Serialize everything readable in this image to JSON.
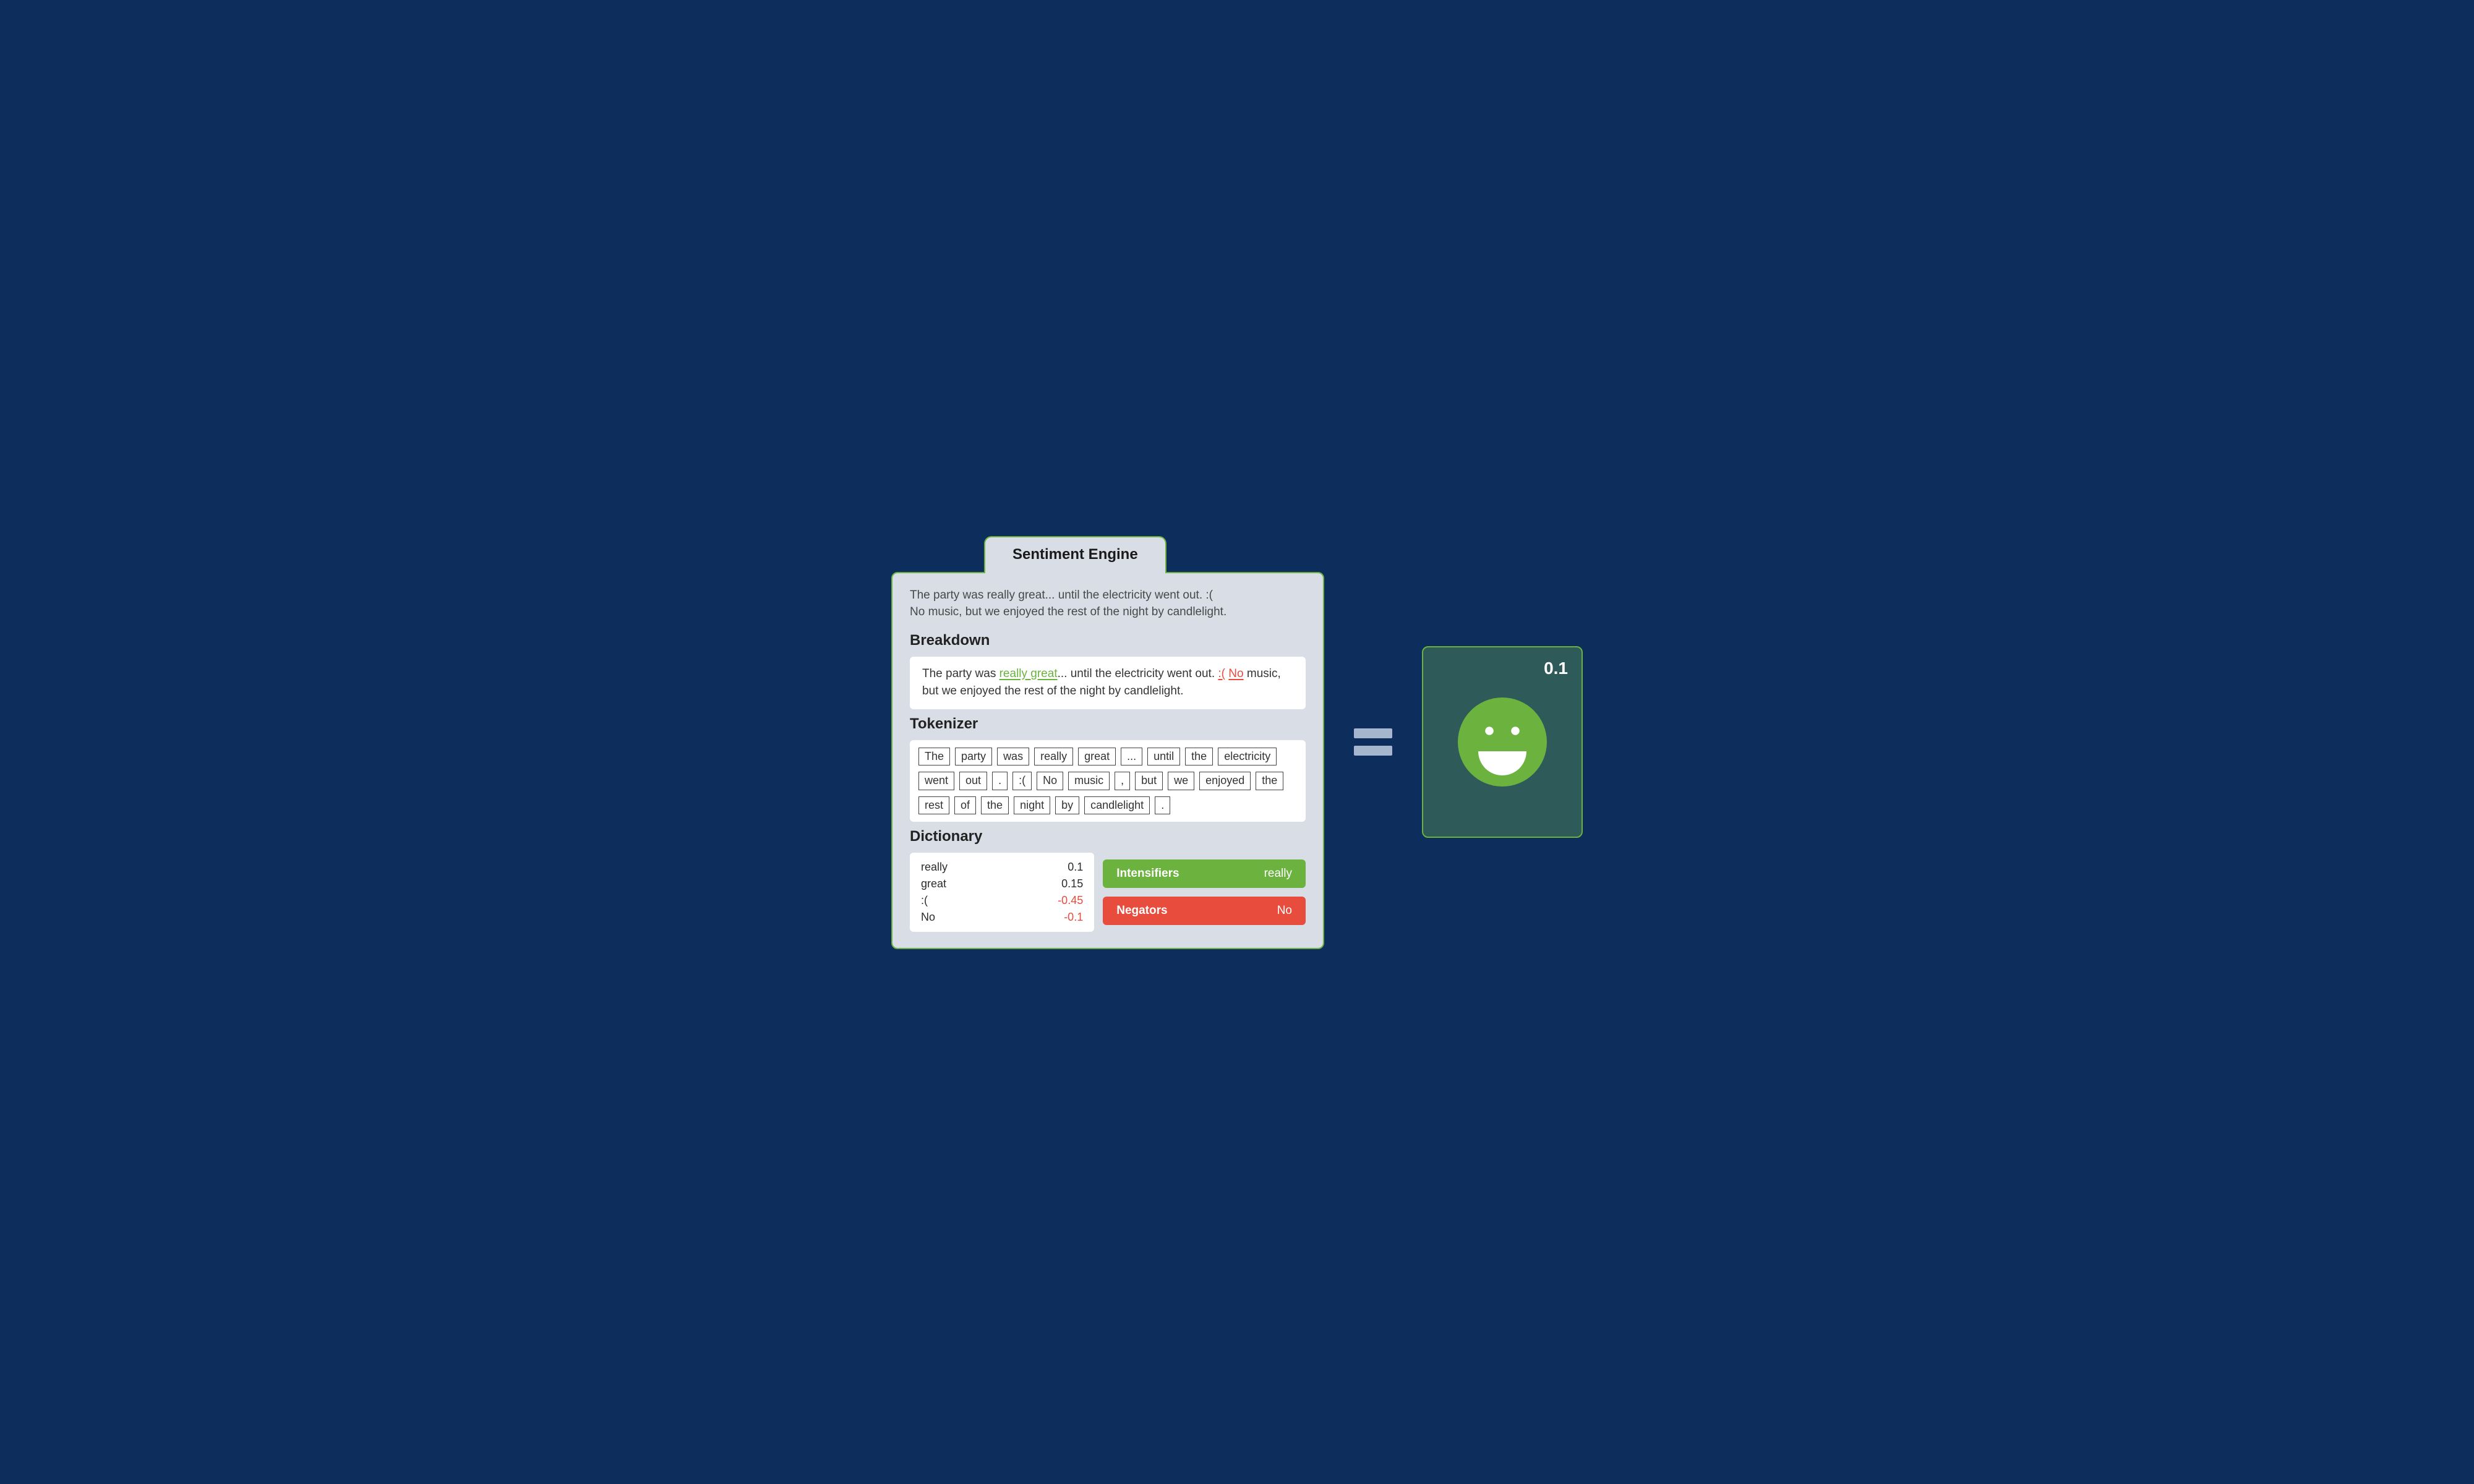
{
  "title": "Sentiment Engine",
  "sample_text": {
    "line1": "The party was really great... until the electricity went out. :(",
    "line2": "No music, but we enjoyed the rest of the night by candlelight."
  },
  "sections": {
    "breakdown": "Breakdown",
    "tokenizer": "Tokenizer",
    "dictionary": "Dictionary"
  },
  "breakdown": {
    "pre": "The party was ",
    "pos_span": "really great",
    "mid1": "... until the electricity went out. ",
    "neg_span1": ":(",
    "space": " ",
    "neg_span2": "No",
    "post": " music, but we enjoyed the rest of the night by candlelight."
  },
  "tokens": [
    "The",
    "party",
    "was",
    "really",
    "great",
    "...",
    "until",
    "the",
    "electricity",
    "went",
    "out",
    ".",
    ":(",
    "No",
    "music",
    ",",
    "but",
    "we",
    "enjoyed",
    "the",
    "rest",
    "of",
    "the",
    "night",
    "by",
    "candlelight",
    "."
  ],
  "dictionary_entries": [
    {
      "term": "really",
      "value": "0.1",
      "neg": false
    },
    {
      "term": "great",
      "value": "0.15",
      "neg": false
    },
    {
      "term": ":(",
      "value": "-0.45",
      "neg": true
    },
    {
      "term": "No",
      "value": "-0.1",
      "neg": true
    }
  ],
  "intensifiers": {
    "label": "Intensifiers",
    "value": "really"
  },
  "negators": {
    "label": "Negators",
    "value": "No"
  },
  "result": {
    "score": "0.1"
  },
  "colors": {
    "bg": "#0d2d5c",
    "panel": "#d8dde6",
    "accent_green": "#6bb33e",
    "accent_red": "#e74c3c",
    "result_bg": "#2f5a5a"
  }
}
